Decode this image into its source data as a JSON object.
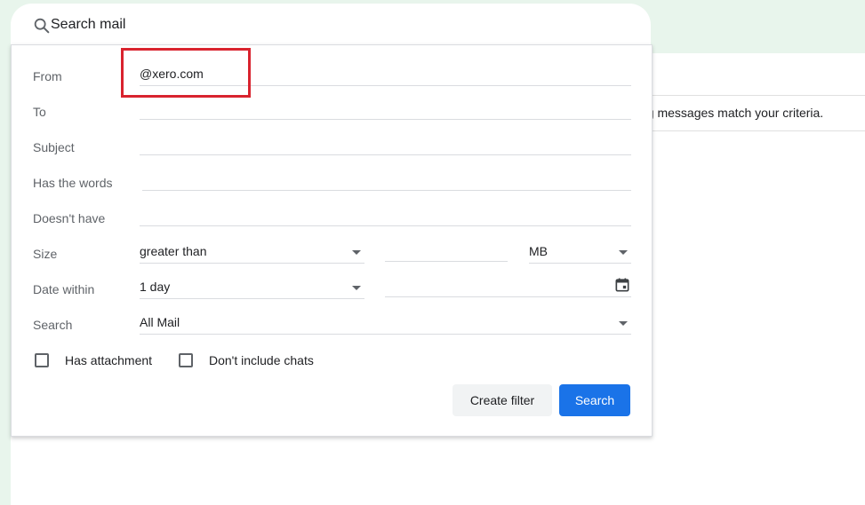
{
  "search": {
    "placeholder": "Search mail"
  },
  "background": {
    "message": "ng messages match your criteria."
  },
  "filter": {
    "from": {
      "label": "From",
      "value": "@xero.com"
    },
    "to": {
      "label": "To",
      "value": ""
    },
    "subject": {
      "label": "Subject",
      "value": ""
    },
    "has_words": {
      "label": "Has the words",
      "value": ""
    },
    "doesnt_have": {
      "label": "Doesn't have",
      "value": ""
    },
    "size": {
      "label": "Size",
      "comparator": "greater than",
      "amount": "",
      "unit": "MB"
    },
    "date_within": {
      "label": "Date within",
      "range": "1 day",
      "date": ""
    },
    "search_in": {
      "label": "Search",
      "value": "All Mail"
    },
    "has_attachment": {
      "label": "Has attachment",
      "checked": false
    },
    "no_chats": {
      "label": "Don't include chats",
      "checked": false
    },
    "create_filter_label": "Create filter",
    "search_label": "Search"
  },
  "colors": {
    "accent": "#1a73e8",
    "highlight": "#d9232e",
    "background": "#e8f5ec"
  }
}
